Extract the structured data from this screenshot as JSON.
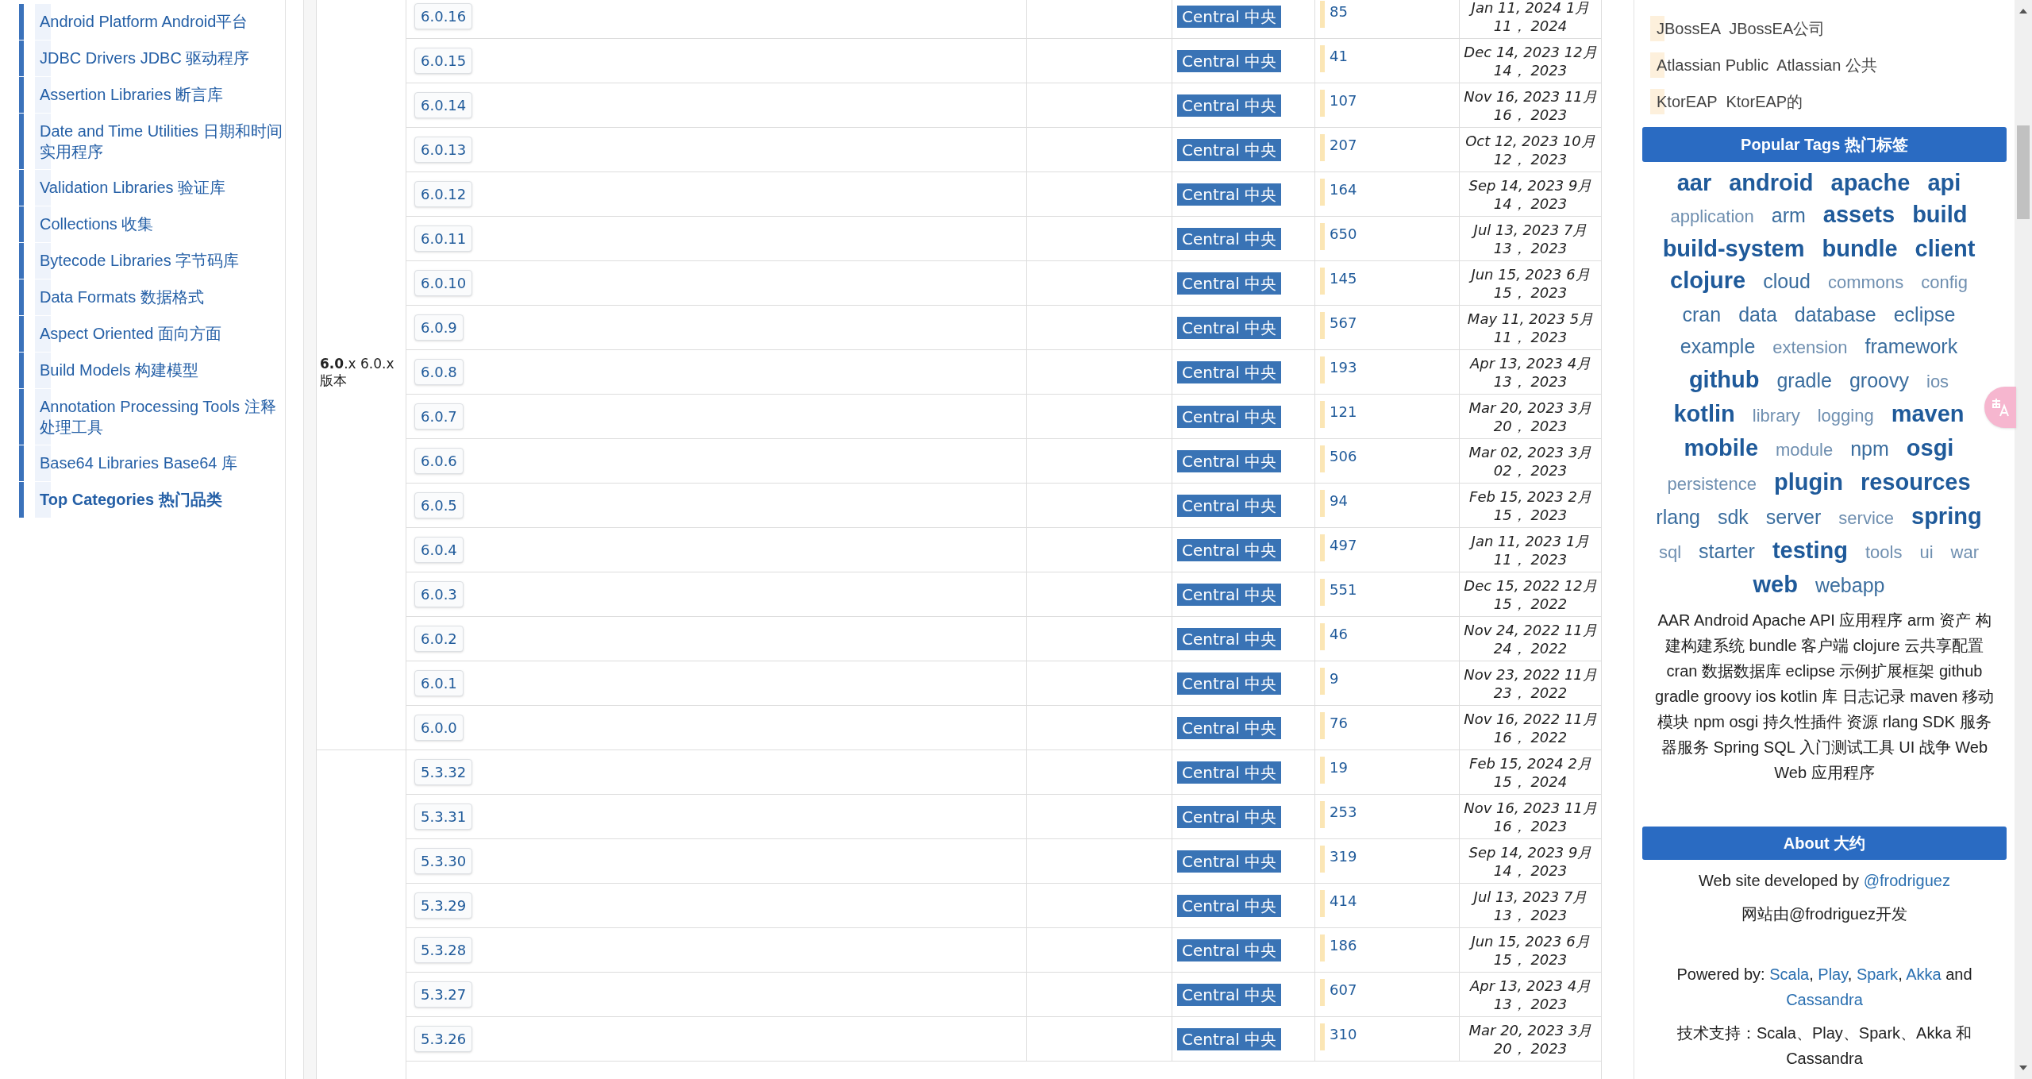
{
  "sidebar": {
    "items": [
      {
        "label": "Android Platform Android平台",
        "kind": "link"
      },
      {
        "label": "JDBC Drivers JDBC 驱动程序",
        "kind": "link"
      },
      {
        "label": "Assertion Libraries 断言库",
        "kind": "link"
      },
      {
        "label": "Date and Time Utilities 日期和时间实用程序",
        "kind": "link"
      },
      {
        "label": "Validation Libraries 验证库",
        "kind": "link"
      },
      {
        "label": "Collections 收集",
        "kind": "link"
      },
      {
        "label": "Bytecode Libraries 字节码库",
        "kind": "link"
      },
      {
        "label": "Data Formats 数据格式",
        "kind": "link"
      },
      {
        "label": "Aspect Oriented 面向方面",
        "kind": "link"
      },
      {
        "label": "Build Models 构建模型",
        "kind": "link"
      },
      {
        "label": "Annotation Processing Tools 注释处理工具",
        "kind": "link"
      },
      {
        "label": "Base64 Libraries Base64 库",
        "kind": "link"
      },
      {
        "label": "Top Categories 热门品类",
        "kind": "heading"
      }
    ]
  },
  "versions": {
    "groups": [
      {
        "label": "**6.0**.x 6.0.x 版本",
        "rows": [
          {
            "version": "6.0.16",
            "repository": "Central 中央",
            "usages": "85",
            "date": "Jan 11, 2024 1月 11， 2024"
          },
          {
            "version": "6.0.15",
            "repository": "Central 中央",
            "usages": "41",
            "date": "Dec 14, 2023 12月 14， 2023"
          },
          {
            "version": "6.0.14",
            "repository": "Central 中央",
            "usages": "107",
            "date": "Nov 16, 2023 11月 16， 2023"
          },
          {
            "version": "6.0.13",
            "repository": "Central 中央",
            "usages": "207",
            "date": "Oct 12, 2023 10月 12， 2023"
          },
          {
            "version": "6.0.12",
            "repository": "Central 中央",
            "usages": "164",
            "date": "Sep 14, 2023 9月 14， 2023"
          },
          {
            "version": "6.0.11",
            "repository": "Central 中央",
            "usages": "650",
            "date": "Jul 13, 2023 7月 13， 2023"
          },
          {
            "version": "6.0.10",
            "repository": "Central 中央",
            "usages": "145",
            "date": "Jun 15, 2023 6月 15， 2023"
          },
          {
            "version": "6.0.9",
            "repository": "Central 中央",
            "usages": "567",
            "date": "May 11, 2023 5月 11， 2023"
          },
          {
            "version": "6.0.8",
            "repository": "Central 中央",
            "usages": "193",
            "date": "Apr 13, 2023 4月 13， 2023"
          },
          {
            "version": "6.0.7",
            "repository": "Central 中央",
            "usages": "121",
            "date": "Mar 20, 2023 3月 20， 2023"
          },
          {
            "version": "6.0.6",
            "repository": "Central 中央",
            "usages": "506",
            "date": "Mar 02, 2023 3月 02， 2023"
          },
          {
            "version": "6.0.5",
            "repository": "Central 中央",
            "usages": "94",
            "date": "Feb 15, 2023 2月 15， 2023"
          },
          {
            "version": "6.0.4",
            "repository": "Central 中央",
            "usages": "497",
            "date": "Jan 11, 2023 1月 11， 2023"
          },
          {
            "version": "6.0.3",
            "repository": "Central 中央",
            "usages": "551",
            "date": "Dec 15, 2022 12月 15， 2022"
          },
          {
            "version": "6.0.2",
            "repository": "Central 中央",
            "usages": "46",
            "date": "Nov 24, 2022 11月 24， 2022"
          },
          {
            "version": "6.0.1",
            "repository": "Central 中央",
            "usages": "9",
            "date": "Nov 23, 2022 11月 23， 2022"
          },
          {
            "version": "6.0.0",
            "repository": "Central 中央",
            "usages": "76",
            "date": "Nov 16, 2022 11月 16， 2022"
          }
        ]
      },
      {
        "rows": [
          {
            "version": "5.3.32",
            "repository": "Central 中央",
            "usages": "19",
            "date": "Feb 15, 2024 2月 15， 2024"
          },
          {
            "version": "5.3.31",
            "repository": "Central 中央",
            "usages": "253",
            "date": "Nov 16, 2023 11月 16， 2023"
          },
          {
            "version": "5.3.30",
            "repository": "Central 中央",
            "usages": "319",
            "date": "Sep 14, 2023 9月 14， 2023"
          },
          {
            "version": "5.3.29",
            "repository": "Central 中央",
            "usages": "414",
            "date": "Jul 13, 2023 7月 13， 2023"
          },
          {
            "version": "5.3.28",
            "repository": "Central 中央",
            "usages": "186",
            "date": "Jun 15, 2023 6月 15， 2023"
          },
          {
            "version": "5.3.27",
            "repository": "Central 中央",
            "usages": "607",
            "date": "Apr 13, 2023 4月 13， 2023"
          },
          {
            "version": "5.3.26",
            "repository": "Central 中央",
            "usages": "310",
            "date": "Mar 20, 2023 3月 20， 2023"
          }
        ]
      }
    ]
  },
  "right_panel": {
    "repositories": [
      "JBossEA  JBossEA公司",
      "Atlassian Public  Atlassian 公共",
      "KtorEAP  KtorEAP的"
    ],
    "tags_title": "Popular Tags 热门标签",
    "tags": [
      {
        "label": "aar",
        "kind": "large"
      },
      {
        "label": "android",
        "kind": "large"
      },
      {
        "label": "apache",
        "kind": "large"
      },
      {
        "label": "api",
        "kind": "large"
      },
      {
        "label": "application",
        "kind": "small"
      },
      {
        "label": "arm",
        "kind": "medium"
      },
      {
        "label": "assets",
        "kind": "large"
      },
      {
        "label": "build",
        "kind": "large"
      },
      {
        "label": "build-system",
        "kind": "large"
      },
      {
        "label": "bundle",
        "kind": "large"
      },
      {
        "label": "client",
        "kind": "large"
      },
      {
        "label": "clojure",
        "kind": "large"
      },
      {
        "label": "cloud",
        "kind": "medium"
      },
      {
        "label": "commons",
        "kind": "small"
      },
      {
        "label": "config",
        "kind": "small"
      },
      {
        "label": "cran",
        "kind": "medium"
      },
      {
        "label": "data",
        "kind": "medium"
      },
      {
        "label": "database",
        "kind": "medium"
      },
      {
        "label": "eclipse",
        "kind": "medium"
      },
      {
        "label": "example",
        "kind": "medium"
      },
      {
        "label": "extension",
        "kind": "small"
      },
      {
        "label": "framework",
        "kind": "medium"
      },
      {
        "label": "github",
        "kind": "large"
      },
      {
        "label": "gradle",
        "kind": "medium"
      },
      {
        "label": "groovy",
        "kind": "medium"
      },
      {
        "label": "ios",
        "kind": "small"
      },
      {
        "label": "kotlin",
        "kind": "large"
      },
      {
        "label": "library",
        "kind": "small"
      },
      {
        "label": "logging",
        "kind": "small"
      },
      {
        "label": "maven",
        "kind": "large"
      },
      {
        "label": "mobile",
        "kind": "large"
      },
      {
        "label": "module",
        "kind": "small"
      },
      {
        "label": "npm",
        "kind": "medium"
      },
      {
        "label": "osgi",
        "kind": "large"
      },
      {
        "label": "persistence",
        "kind": "small"
      },
      {
        "label": "plugin",
        "kind": "large"
      },
      {
        "label": "resources",
        "kind": "large"
      },
      {
        "label": "rlang",
        "kind": "medium"
      },
      {
        "label": "sdk",
        "kind": "medium"
      },
      {
        "label": "server",
        "kind": "medium"
      },
      {
        "label": "service",
        "kind": "small"
      },
      {
        "label": "spring",
        "kind": "large"
      },
      {
        "label": "sql",
        "kind": "small"
      },
      {
        "label": "starter",
        "kind": "medium"
      },
      {
        "label": "testing",
        "kind": "large"
      },
      {
        "label": "tools",
        "kind": "small"
      },
      {
        "label": "ui",
        "kind": "small"
      },
      {
        "label": "war",
        "kind": "small"
      },
      {
        "label": "web",
        "kind": "large"
      },
      {
        "label": "webapp",
        "kind": "medium"
      }
    ],
    "tags_translation": "AAR Android Apache API 应用程序 arm 资产 构建构建系统 bundle 客户端 clojure 云共享配置 cran 数据数据库 eclipse 示例扩展框架 github gradle groovy ios kotlin 库 日志记录 maven 移动模块 npm osgi 持久性插件 资源 rlang SDK 服务器服务 Spring SQL 入门测试工具 UI 战争 Web Web 应用程序",
    "about_title": "About 大约",
    "developed": [
      {
        "text": "Web site developed by "
      },
      {
        "link": "@frodriguez"
      }
    ],
    "developed_translation": "网站由@frodriguez开发",
    "powered": [
      {
        "text": "Powered by: "
      },
      {
        "link": "Scala"
      },
      {
        "text": ", "
      },
      {
        "link": "Play"
      },
      {
        "text": ", "
      },
      {
        "link": "Spark"
      },
      {
        "text": ", "
      },
      {
        "link": "Akka"
      },
      {
        "text": " and "
      },
      {
        "link": "Cassandra"
      }
    ],
    "powered_translation": "技术支持：Scala、Play、Spark、Akka 和 Cassandra"
  }
}
